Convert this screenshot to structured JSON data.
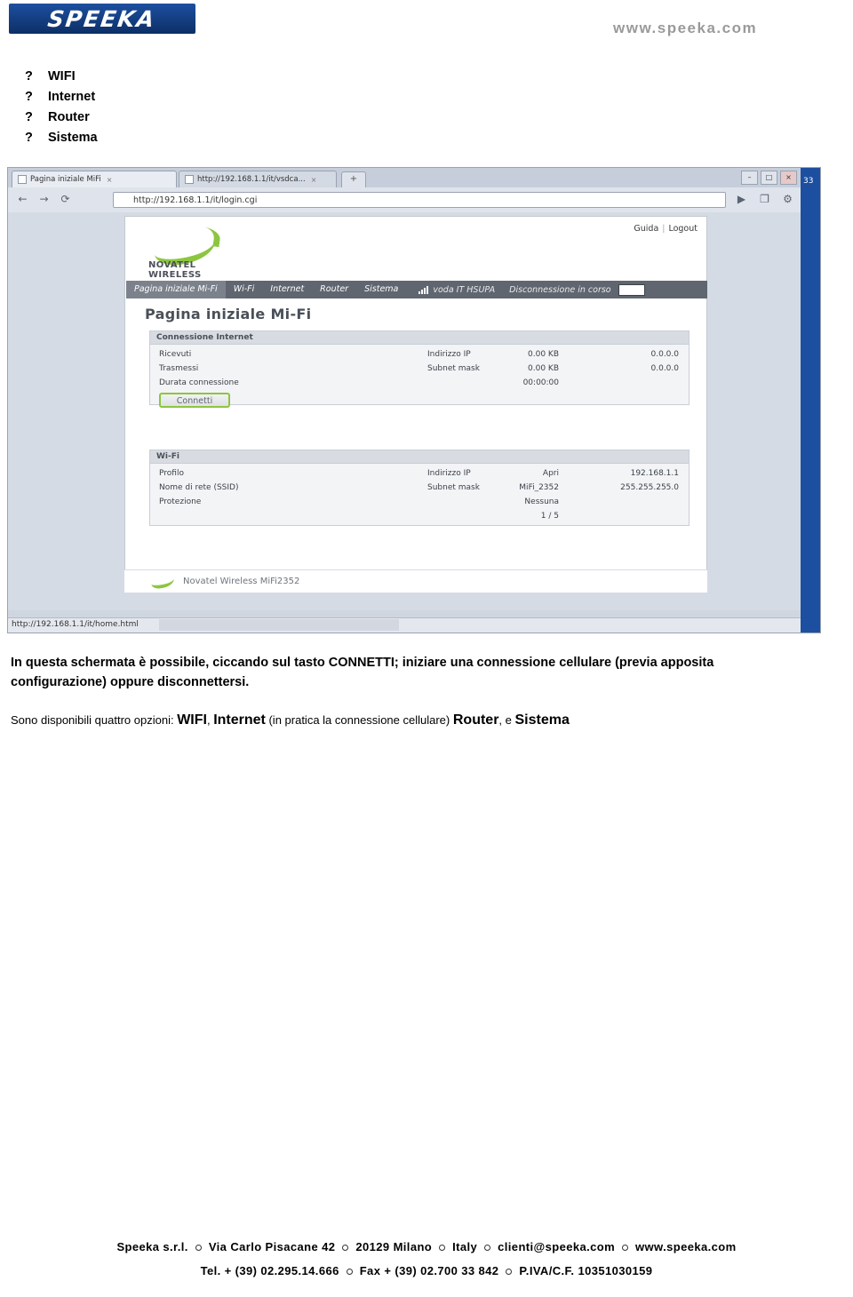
{
  "header": {
    "logo_text": "SPEEKA",
    "site_url": "www.speeka.com"
  },
  "bullets": [
    {
      "mark": "?",
      "label": "WIFI"
    },
    {
      "mark": "?",
      "label": "Internet"
    },
    {
      "mark": "?",
      "label": "Router"
    },
    {
      "mark": "?",
      "label": "Sistema"
    }
  ],
  "screenshot": {
    "browser": {
      "tab1": "Pagina iniziale MiFi",
      "tab1_close": "×",
      "tab2": "http://192.168.1.1/it/vsdca...",
      "tab2_close": "×",
      "newtab": "+",
      "minimize": "–",
      "maximize": "□",
      "close": "×",
      "back_icon": "←",
      "forward_icon": "→",
      "reload_icon": "⟳",
      "star_icon": "☆",
      "url": "http://192.168.1.1/it/login.cgi",
      "go_icon": "▶",
      "page_icon": "❐",
      "tools_icon": "⚙",
      "dropdown_icon": "▾",
      "page_number": "33"
    },
    "router_page": {
      "help_link": "Guida",
      "separator": "|",
      "logout_link": "Logout",
      "brand": "NOVATEL WIRELESS",
      "menu": [
        "Pagina iniziale Mi-Fi",
        "Wi-Fi",
        "Internet",
        "Router",
        "Sistema"
      ],
      "carrier": "voda IT  HSUPA",
      "connection_status": "Disconnessione in corso",
      "title": "Pagina iniziale Mi-Fi",
      "internet_panel": {
        "heading": "Connessione Internet",
        "rows": [
          {
            "label": "Ricevuti",
            "value": "0.00 KB",
            "label2": "Indirizzo IP",
            "value2": "0.0.0.0"
          },
          {
            "label": "Trasmessi",
            "value": "0.00 KB",
            "label2": "Subnet mask",
            "value2": "0.0.0.0"
          },
          {
            "label": "Durata connessione",
            "value": "00:00:00",
            "label2": "",
            "value2": ""
          }
        ],
        "button": "Connetti"
      },
      "wifi_panel": {
        "heading": "Wi-Fi",
        "rows": [
          {
            "label": "Profilo",
            "value": "Apri",
            "label2": "Indirizzo IP",
            "value2": "192.168.1.1"
          },
          {
            "label": "Nome di rete (SSID)",
            "value": "MiFi_2352",
            "label2": "Subnet mask",
            "value2": "255.255.255.0"
          },
          {
            "label": "Protezione",
            "value": "Nessuna",
            "label2": "",
            "value2": ""
          },
          {
            "label": "",
            "value": "1 / 5",
            "label2": "",
            "value2": ""
          }
        ]
      },
      "footer_text": "Novatel Wireless MiFi2352"
    },
    "status_bar": "http://192.168.1.1/it/home.html"
  },
  "body": {
    "paragraph1": "In questa schermata è possibile, ciccando sul tasto CONNETTI; iniziare una connessione cellulare (previa apposita configurazione) oppure disconnettersi.",
    "paragraph2_pre": "Sono disponibili quattro opzioni: ",
    "paragraph2_opt1": "WIFI",
    "paragraph2_mid1": ", ",
    "paragraph2_opt2": "Internet",
    "paragraph2_mid2": " (in pratica la connessione cellulare) ",
    "paragraph2_opt3": "Router",
    "paragraph2_mid3": ", e ",
    "paragraph2_opt4": "Sistema"
  },
  "footer": {
    "line1_a": "Speeka  s.r.l.",
    "line1_b": "Via Carlo Pisacane 42",
    "line1_c": "20129  Milano",
    "line1_d": "Italy",
    "line1_e": "clienti@speeka.com",
    "line1_f": "www.speeka.com",
    "line2_a": "Tel. + (39) 02.295.14.666",
    "line2_b": "Fax + (39) 02.700 33 842",
    "line2_c": "P.IVA/C.F.  10351030159"
  }
}
